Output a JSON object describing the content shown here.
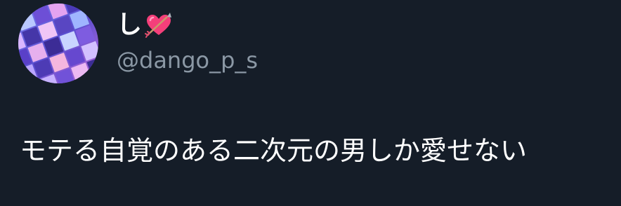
{
  "tweet": {
    "author": {
      "display_name": "し",
      "emoji_icon": "heart-with-arrow-icon",
      "handle": "@dango_p_s",
      "avatar_icon": "avatar-image"
    },
    "text": "モテる自覚のある二次元の男しか愛せない"
  },
  "colors": {
    "background": "#151d28",
    "name": "#ffffff",
    "handle": "#8b98a5",
    "text": "#ffffff",
    "heart": "#f43f7a"
  }
}
